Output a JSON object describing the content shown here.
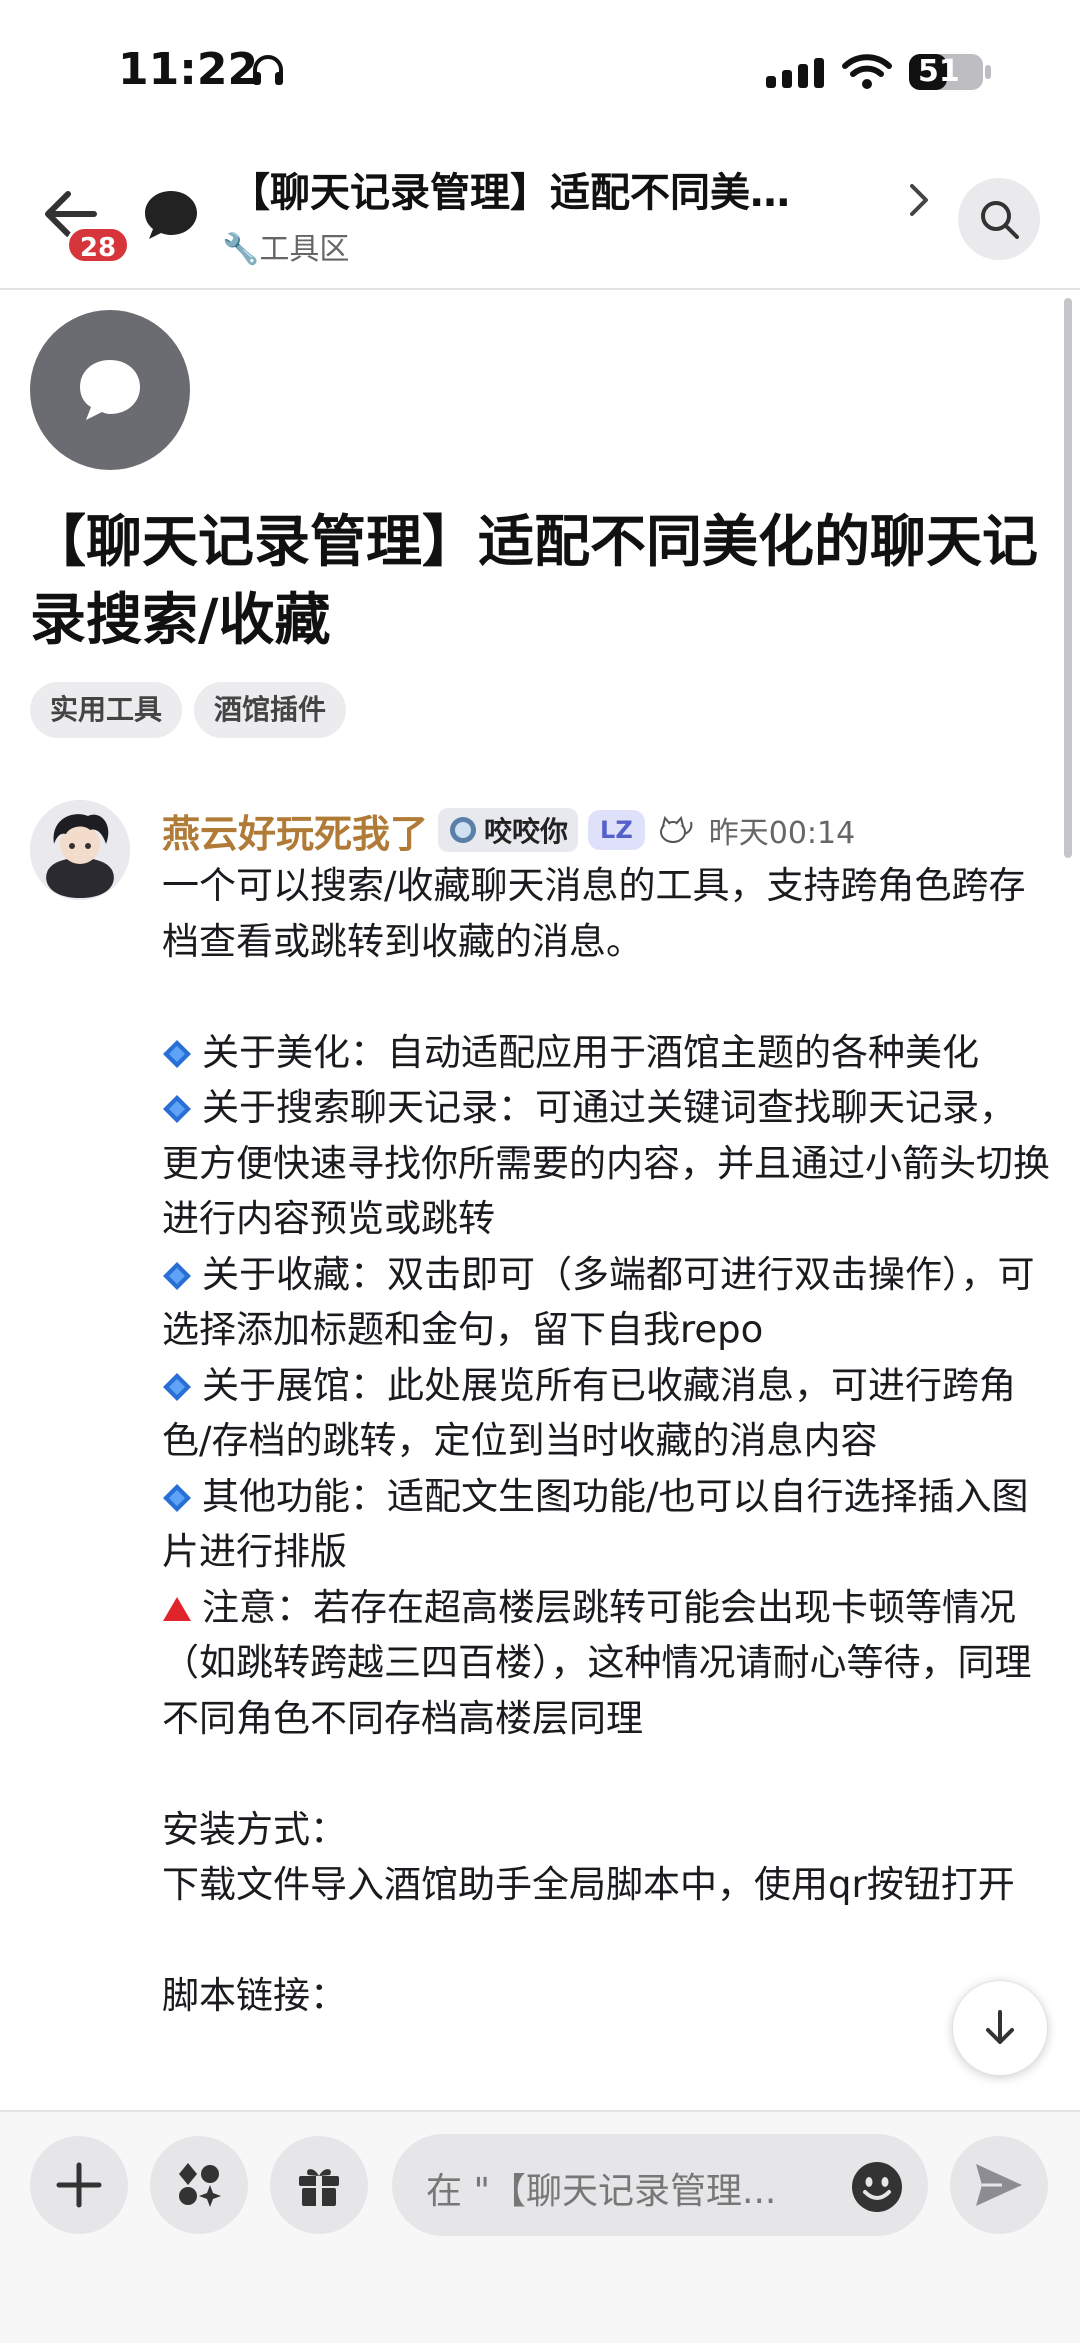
{
  "status_bar": {
    "time": "11:22",
    "battery": "51"
  },
  "header": {
    "notification_count": "28",
    "title": "【聊天记录管理】适配不同美…",
    "category": "🔧工具区"
  },
  "topic": {
    "title": "【聊天记录管理】适配不同美化的聊天记录搜索/收藏",
    "tags": [
      "实用工具",
      "酒馆插件"
    ]
  },
  "post": {
    "author": "燕云好玩死我了",
    "flair": "咬咬你",
    "lz_badge": "LZ",
    "time": "昨天00:14",
    "paragraphs": [
      "一个可以搜索/收藏聊天消息的工具，支持跨角色跨存档查看或跳转到收藏的消息。",
      "",
      "关于美化：自动适配应用于酒馆主题的各种美化",
      "关于搜索聊天记录：可通过关键词查找聊天记录，更方便快速寻找你所需要的内容，并且通过小箭头切换进行内容预览或跳转",
      "关于收藏：双击即可（多端都可进行双击操作），可选择添加标题和金句，留下自我repo",
      "关于展馆：此处展览所有已收藏消息，可进行跨角色/存档的跳转，定位到当时收藏的消息内容",
      "其他功能：适配文生图功能/也可以自行选择插入图片进行排版",
      "注意：若存在超高楼层跳转可能会出现卡顿等情况（如跳转跨越三四百楼），这种情况请耐心等待，同理不同角色不同存档高楼层同理",
      "",
      "安装方式：",
      "下载文件导入酒馆助手全局脚本中，使用qr按钮打开",
      "",
      "脚本链接："
    ]
  },
  "composer": {
    "placeholder": "在 \"【聊天记录管理..."
  },
  "colors": {
    "accent": "#b07a37",
    "badge_red": "#d6353b",
    "lz_blue": "#5560c8"
  }
}
